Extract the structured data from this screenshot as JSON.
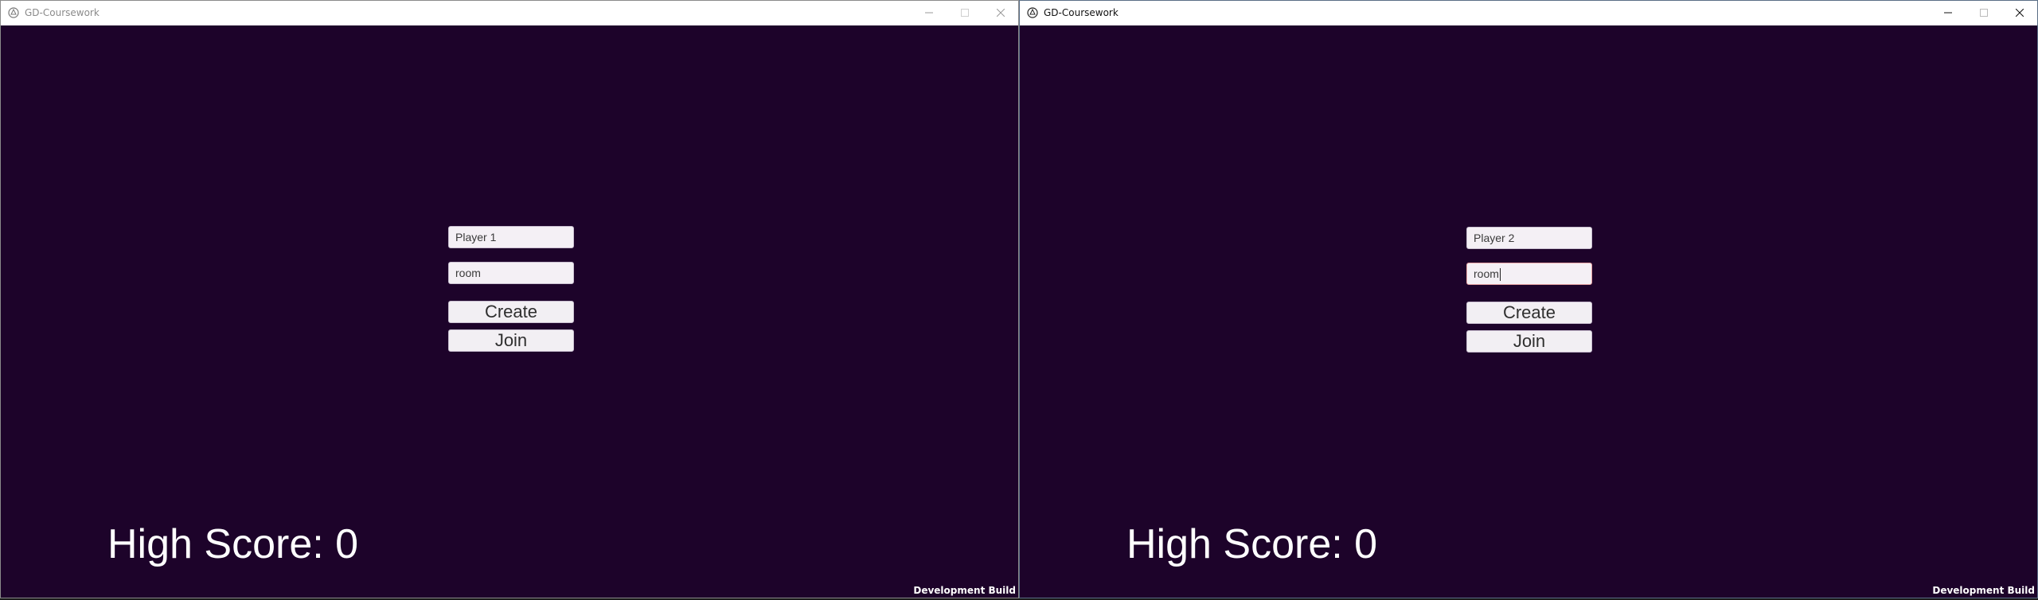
{
  "windows": [
    {
      "title": "GD-Coursework",
      "title_color": "#8a8a8a",
      "player_name": "Player 1",
      "room": "room",
      "room_focused": false,
      "create_label": "Create",
      "join_label": "Join",
      "high_score_label": "High Score:",
      "high_score_value": "0",
      "dev_build": "Development Build"
    },
    {
      "title": "GD-Coursework",
      "title_color": "#111111",
      "player_name": "Player 2",
      "room": "room",
      "room_focused": true,
      "create_label": "Create",
      "join_label": "Join",
      "high_score_label": "High Score:",
      "high_score_value": "0",
      "dev_build": "Development Build"
    }
  ],
  "caption_buttons": {
    "minimize": "minimize-icon",
    "maximize": "maximize-icon",
    "close": "close-icon"
  },
  "colors": {
    "game_background": "#1d032a",
    "field_background": "#f4f0f5",
    "text_white": "#ffffff"
  }
}
